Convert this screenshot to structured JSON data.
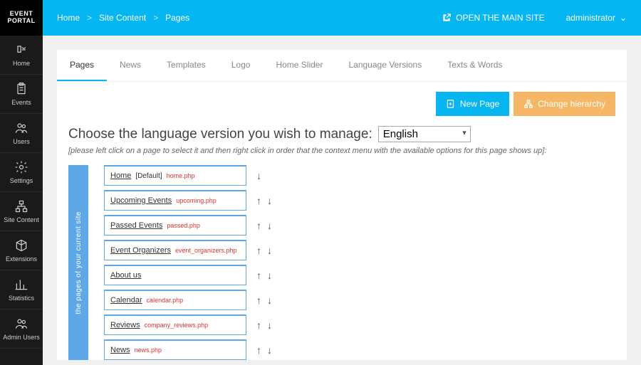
{
  "logo": {
    "line1": "EVENT",
    "line2": "PORTAL"
  },
  "sidebar": [
    {
      "label": "Home",
      "icon": "home-icon"
    },
    {
      "label": "Events",
      "icon": "clipboard-icon"
    },
    {
      "label": "Users",
      "icon": "users-icon"
    },
    {
      "label": "Settings",
      "icon": "gear-icon"
    },
    {
      "label": "Site Content",
      "icon": "hierarchy-icon"
    },
    {
      "label": "Extensions",
      "icon": "cube-icon"
    },
    {
      "label": "Statistics",
      "icon": "chart-icon"
    },
    {
      "label": "Admin Users",
      "icon": "admin-users-icon"
    }
  ],
  "breadcrumb": [
    "Home",
    "Site Content",
    "Pages"
  ],
  "topbar": {
    "open_site": "OPEN THE MAIN SITE",
    "admin": "administrator"
  },
  "tabs": [
    "Pages",
    "News",
    "Templates",
    "Logo",
    "Home Slider",
    "Language Versions",
    "Texts & Words"
  ],
  "active_tab": 0,
  "actions": {
    "new_page": "New Page",
    "hierarchy": "Change hierarchy"
  },
  "heading": "Choose the language version you wish to manage:",
  "language_options": [
    "English"
  ],
  "language_selected": "English",
  "hint": "[please left click on a page to select it and then right click in order that the context menu with the available options for this page shows up]:",
  "tree_label": "the pages of your current site",
  "pages": [
    {
      "title": "Home",
      "default": "[Default]",
      "file": "home.php",
      "up": false,
      "down": true
    },
    {
      "title": "Upcoming Events",
      "default": "",
      "file": "upcoming.php",
      "up": true,
      "down": true
    },
    {
      "title": "Passed Events",
      "default": "",
      "file": "passed.php",
      "up": true,
      "down": true
    },
    {
      "title": "Event Organizers",
      "default": "",
      "file": "event_organizers.php",
      "up": true,
      "down": true
    },
    {
      "title": "About us",
      "default": "",
      "file": "",
      "up": true,
      "down": true
    },
    {
      "title": "Calendar",
      "default": "",
      "file": "calendar.php",
      "up": true,
      "down": true
    },
    {
      "title": "Reviews",
      "default": "",
      "file": "company_reviews.php",
      "up": true,
      "down": true
    },
    {
      "title": "News",
      "default": "",
      "file": "news.php",
      "up": true,
      "down": true
    }
  ]
}
